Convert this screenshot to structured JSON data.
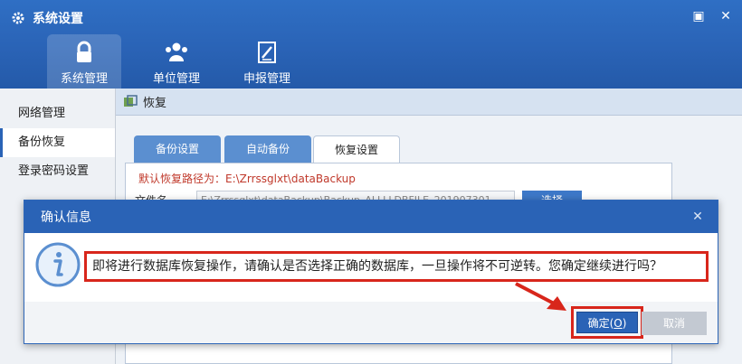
{
  "window": {
    "title": "系统设置",
    "gear_icon": "gear-icon",
    "restore_icon": "window-restore-icon",
    "close_icon": "close-icon"
  },
  "topnav": [
    {
      "label": "系统管理",
      "icon": "lock-icon",
      "active": true
    },
    {
      "label": "单位管理",
      "icon": "users-icon",
      "active": false
    },
    {
      "label": "申报管理",
      "icon": "edit-document-icon",
      "active": false
    }
  ],
  "sidebar": {
    "items": [
      {
        "label": "网络管理",
        "active": false
      },
      {
        "label": "备份恢复",
        "active": true
      },
      {
        "label": "登录密码设置",
        "active": false
      }
    ]
  },
  "content": {
    "title": "恢复",
    "tabs": [
      {
        "label": "备份设置",
        "active": false
      },
      {
        "label": "自动备份",
        "active": false
      },
      {
        "label": "恢复设置",
        "active": true
      }
    ],
    "default_path_text": "默认恢复路径为：E:\\Zrrssglxt\\dataBackup",
    "file_label": "文件名",
    "file_value": "E:\\Zrrssglxt\\dataBackup\\Backup_ALLLLDBFILE_201907301",
    "select_button": "选择"
  },
  "dialog": {
    "title": "确认信息",
    "message": "即将进行数据库恢复操作，请确认是否选择正确的数据库，一旦操作将不可逆转。您确定继续进行吗？",
    "ok_label": "确定(",
    "ok_hotkey": "O",
    "ok_suffix": ")",
    "cancel_label": "取消"
  },
  "colors": {
    "accent": "#2a63b6",
    "highlight": "#d8261b",
    "path_text": "#c0392b"
  }
}
